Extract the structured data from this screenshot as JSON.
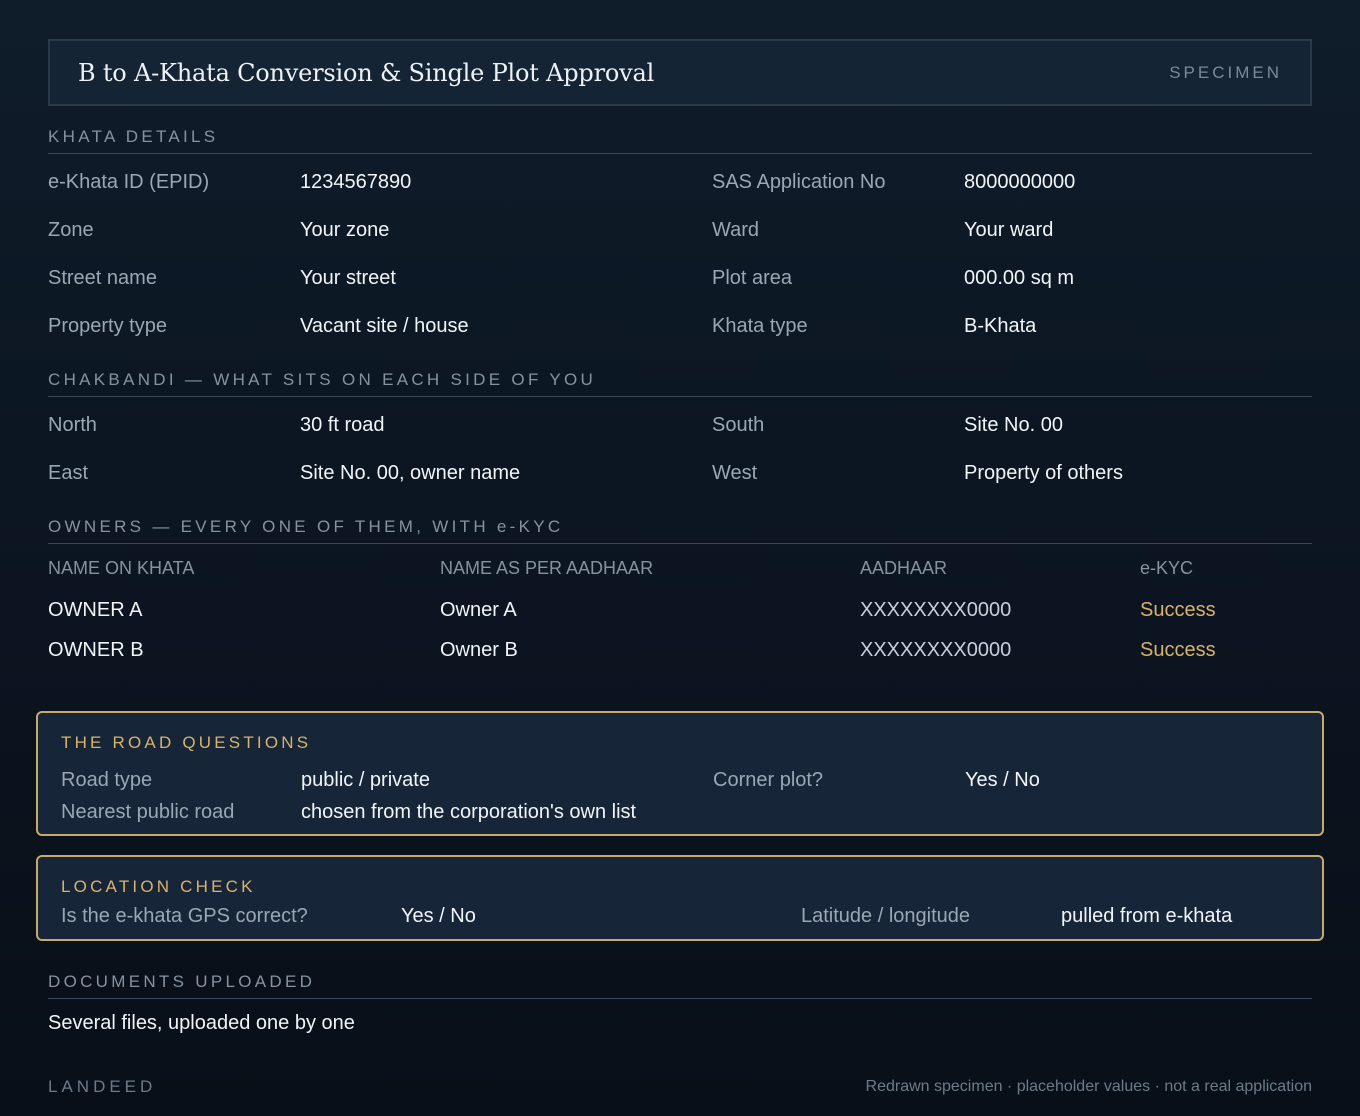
{
  "header": {
    "title": "B to A-Khata Conversion & Single Plot Approval",
    "badge": "SPECIMEN"
  },
  "khata": {
    "heading": "KHATA DETAILS",
    "fields": [
      {
        "label": "e-Khata ID (EPID)",
        "value": "1234567890"
      },
      {
        "label": "SAS Application No",
        "value": "8000000000"
      },
      {
        "label": "Zone",
        "value": "Your zone"
      },
      {
        "label": "Ward",
        "value": "Your ward"
      },
      {
        "label": "Street name",
        "value": "Your street"
      },
      {
        "label": "Plot area",
        "value": "000.00 sq m"
      },
      {
        "label": "Property type",
        "value": "Vacant site / house"
      },
      {
        "label": "Khata type",
        "value": "B-Khata"
      }
    ]
  },
  "chakbandi": {
    "heading": "CHAKBANDI — WHAT SITS ON EACH SIDE OF YOU",
    "fields": [
      {
        "label": "North",
        "value": "30 ft road"
      },
      {
        "label": "South",
        "value": "Site No. 00"
      },
      {
        "label": "East",
        "value": "Site No. 00, owner name"
      },
      {
        "label": "West",
        "value": "Property of others"
      }
    ]
  },
  "owners": {
    "heading": "OWNERS — EVERY ONE OF THEM, WITH e-KYC",
    "columns": [
      "NAME ON KHATA",
      "NAME AS PER AADHAAR",
      "AADHAAR",
      "e-KYC"
    ],
    "rows": [
      [
        "OWNER A",
        "Owner A",
        "XXXXXXXX0000",
        "Success"
      ],
      [
        "OWNER B",
        "Owner B",
        "XXXXXXXX0000",
        "Success"
      ]
    ]
  },
  "road": {
    "heading": "THE ROAD QUESTIONS",
    "road_type_label": "Road type",
    "road_type_value": "public / private",
    "corner_label": "Corner plot?",
    "corner_value": "Yes / No",
    "nearest_label": "Nearest public road",
    "nearest_value": "chosen from the corporation's own list"
  },
  "location": {
    "heading": "LOCATION CHECK",
    "gps_label": "Is the e-khata GPS correct?",
    "gps_value": "Yes / No",
    "latlng_label": "Latitude / longitude",
    "latlng_value": "pulled from e-khata"
  },
  "documents": {
    "heading": "DOCUMENTS UPLOADED",
    "text": "Several files, uploaded one by one"
  },
  "footer": {
    "brand": "LANDEED",
    "note": "Redrawn specimen · placeholder values · not a real application"
  },
  "colors": {
    "background": "#0b1420",
    "accent_gold": "#d9b36a",
    "box_border": "#c9a86a"
  }
}
